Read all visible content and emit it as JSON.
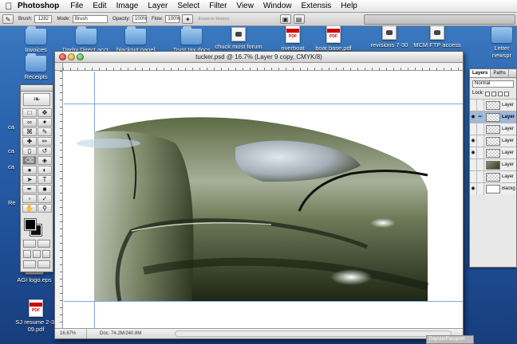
{
  "menubar": {
    "app_name": "Photoshop",
    "items": [
      "File",
      "Edit",
      "Image",
      "Layer",
      "Select",
      "Filter",
      "View",
      "Window",
      "Extensis",
      "Help"
    ]
  },
  "options": {
    "brush_label": "Brush:",
    "brush_size": "1282",
    "mode_label": "Mode:",
    "mode_value": "Brush",
    "opacity_label": "Opacity:",
    "opacity_value": "100%",
    "flow_label": "Flow:",
    "flow_value": "100%",
    "erase_history": "Erase to History"
  },
  "desktop": {
    "icons": [
      {
        "label": "Invoices",
        "type": "folder"
      },
      {
        "label": "Darby Direct acct. stuff",
        "type": "folder"
      },
      {
        "label": "blackout panel receipt",
        "type": "folder"
      },
      {
        "label": "Trust tax docs",
        "type": "folder"
      },
      {
        "label": "chuck most forum",
        "type": "photo"
      },
      {
        "label": "riverboat dimensions.pdf",
        "type": "pdf"
      },
      {
        "label": "boat base.pdf",
        "type": "pdf"
      },
      {
        "label": "revisions 7-30",
        "type": "photo"
      },
      {
        "label": "MCM FTP access",
        "type": "photo"
      },
      {
        "label": "Letter newspr",
        "type": "folder"
      },
      {
        "label": "Receipts",
        "type": "folder"
      },
      {
        "label": "AGI logo.eps",
        "type": "drive"
      },
      {
        "label": "SJ resume 2-3-09.pdf",
        "type": "pdf"
      }
    ],
    "partial_labels": [
      "ca",
      "ca",
      "Re",
      "ca"
    ]
  },
  "document": {
    "title": "tucker.psd @ 16.7% (Layer 9 copy, CMYK/8)",
    "zoom": "16.67%",
    "doc_size": "Doc: 74.2M/240.8M"
  },
  "layers_panel": {
    "tabs": [
      "Layers",
      "Paths"
    ],
    "blend_mode": "Normal",
    "lock_label": "Lock:",
    "layers": [
      {
        "name": "Layer",
        "visible": false,
        "selected": false,
        "thumb": "checker"
      },
      {
        "name": "Layer",
        "visible": true,
        "selected": true,
        "thumb": "checker"
      },
      {
        "name": "Layer",
        "visible": false,
        "selected": false,
        "thumb": "checker"
      },
      {
        "name": "Layer",
        "visible": true,
        "selected": false,
        "thumb": "checker"
      },
      {
        "name": "Layer",
        "visible": true,
        "selected": false,
        "thumb": "checker"
      },
      {
        "name": "Layer",
        "visible": false,
        "selected": false,
        "thumb": "img"
      },
      {
        "name": "Layer",
        "visible": false,
        "selected": false,
        "thumb": "checker"
      },
      {
        "name": "Backg",
        "visible": true,
        "selected": false,
        "thumb": "white"
      }
    ]
  },
  "footer_tag": "DaystarPassport"
}
